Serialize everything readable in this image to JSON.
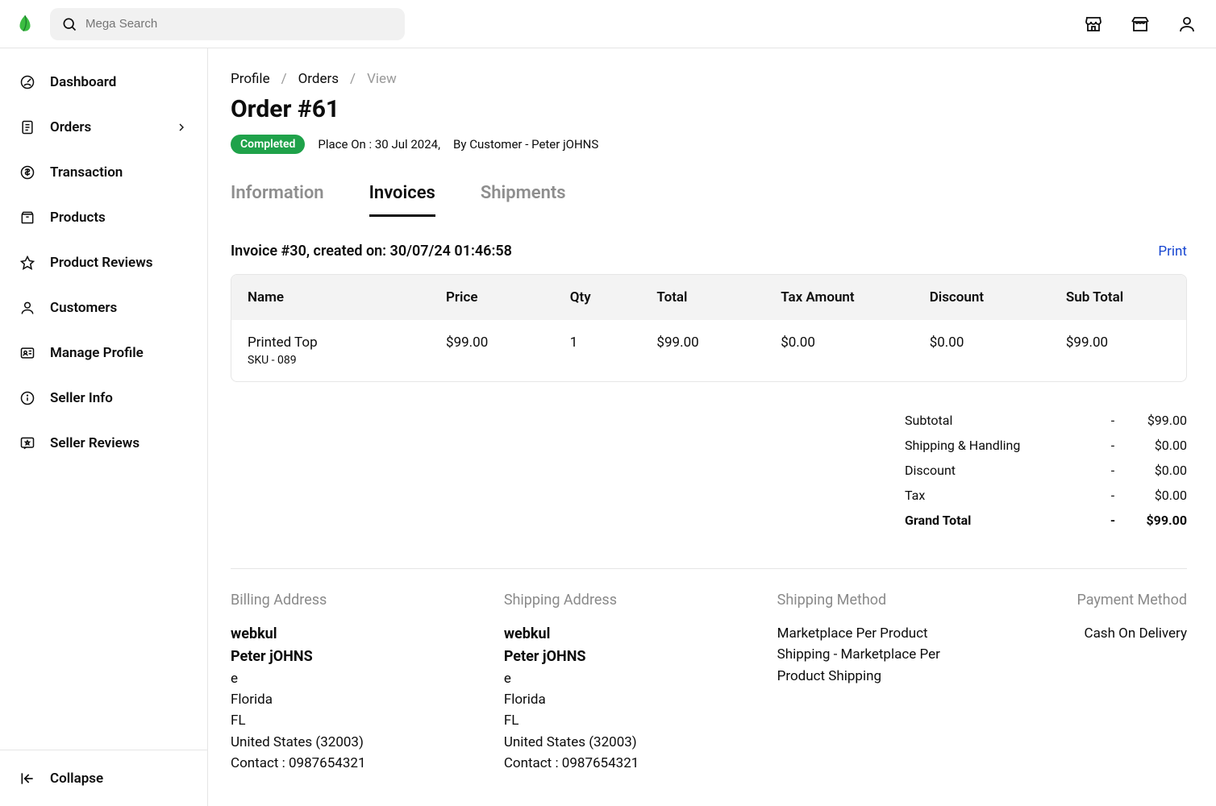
{
  "search": {
    "placeholder": "Mega Search"
  },
  "sidebar": {
    "items": [
      {
        "label": "Dashboard"
      },
      {
        "label": "Orders"
      },
      {
        "label": "Transaction"
      },
      {
        "label": "Products"
      },
      {
        "label": "Product Reviews"
      },
      {
        "label": "Customers"
      },
      {
        "label": "Manage Profile"
      },
      {
        "label": "Seller Info"
      },
      {
        "label": "Seller Reviews"
      }
    ],
    "collapse_label": "Collapse"
  },
  "breadcrumb": {
    "profile": "Profile",
    "orders": "Orders",
    "view": "View",
    "sep": "/"
  },
  "page": {
    "title": "Order #61",
    "status": "Completed",
    "placed_on": "Place On : 30 Jul 2024,",
    "by": "By Customer - Peter jOHNS"
  },
  "tabs": {
    "information": "Information",
    "invoices": "Invoices",
    "shipments": "Shipments"
  },
  "invoice": {
    "heading": "Invoice #30, created on: 30/07/24 01:46:58",
    "print": "Print",
    "columns": {
      "name": "Name",
      "price": "Price",
      "qty": "Qty",
      "total": "Total",
      "tax": "Tax Amount",
      "discount": "Discount",
      "subtotal": "Sub Total"
    },
    "item": {
      "name": "Printed Top",
      "sku": "SKU - 089",
      "price": "$99.00",
      "qty": "1",
      "total": "$99.00",
      "tax": "$0.00",
      "discount": "$0.00",
      "subtotal": "$99.00"
    }
  },
  "summary": {
    "rows": [
      {
        "label": "Subtotal",
        "value": "$99.00"
      },
      {
        "label": "Shipping & Handling",
        "value": "$0.00"
      },
      {
        "label": "Discount",
        "value": "$0.00"
      },
      {
        "label": "Tax",
        "value": "$0.00"
      }
    ],
    "grand_label": "Grand Total",
    "grand_value": "$99.00",
    "dash": "-"
  },
  "addresses": {
    "billing_title": "Billing Address",
    "shipping_title": "Shipping Address",
    "shipping_method_title": "Shipping Method",
    "payment_method_title": "Payment Method",
    "billing": {
      "company": "webkul",
      "name": "Peter jOHNS",
      "street": "e",
      "city": "Florida",
      "state": "FL",
      "country": "United States (32003)",
      "contact": "Contact : 0987654321"
    },
    "shipping": {
      "company": "webkul",
      "name": "Peter jOHNS",
      "street": "e",
      "city": "Florida",
      "state": "FL",
      "country": "United States (32003)",
      "contact": "Contact : 0987654321"
    },
    "shipping_method": "Marketplace Per Product Shipping - Marketplace Per Product Shipping",
    "payment_method": "Cash On Delivery"
  }
}
